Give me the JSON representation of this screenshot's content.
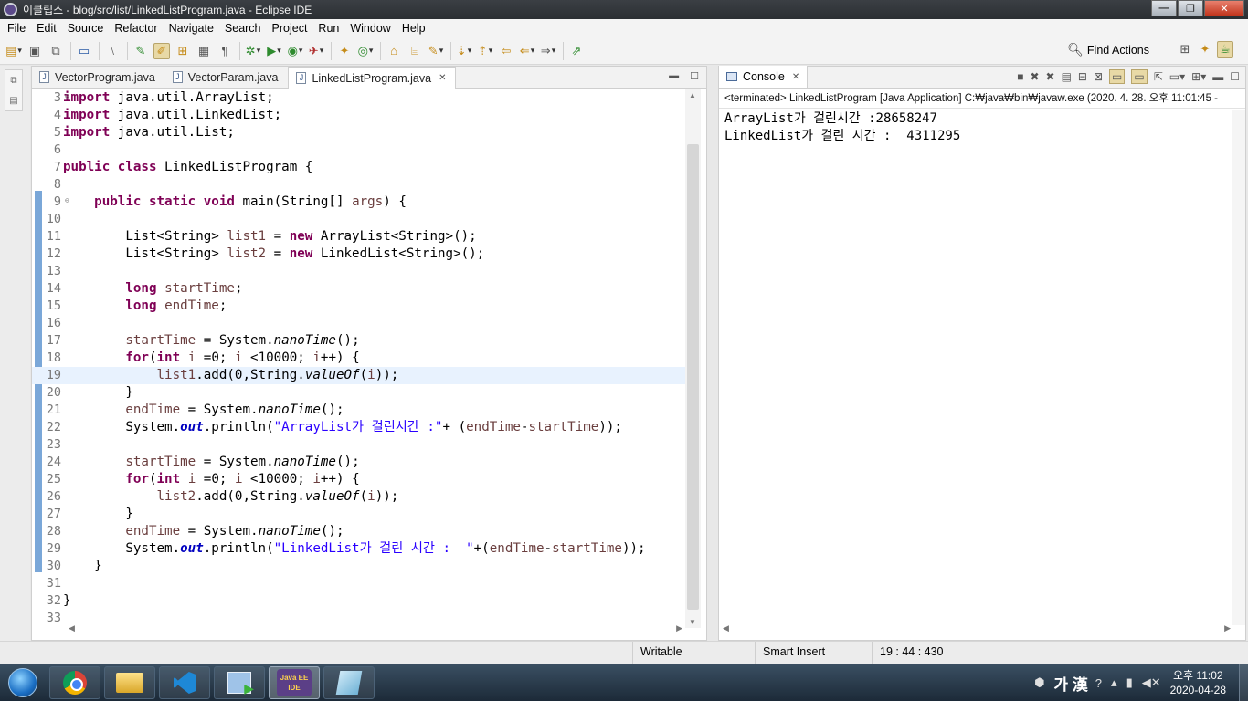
{
  "window": {
    "title": "이클립스 - blog/src/list/LinkedListProgram.java - Eclipse IDE",
    "controls": [
      "—",
      "❐",
      "✕"
    ]
  },
  "menu": [
    "File",
    "Edit",
    "Source",
    "Refactor",
    "Navigate",
    "Search",
    "Project",
    "Run",
    "Window",
    "Help"
  ],
  "toolbar": {
    "find_actions": "Find Actions"
  },
  "editor": {
    "tabs": [
      {
        "label": "VectorProgram.java",
        "active": false
      },
      {
        "label": "VectorParam.java",
        "active": false
      },
      {
        "label": "LinkedListProgram.java",
        "active": true
      }
    ],
    "line_numbers": [
      "3",
      "4",
      "5",
      "6",
      "7",
      "8",
      "9",
      "10",
      "11",
      "12",
      "13",
      "14",
      "15",
      "16",
      "17",
      "18",
      "19",
      "20",
      "21",
      "22",
      "23",
      "24",
      "25",
      "26",
      "27",
      "28",
      "29",
      "30",
      "31",
      "32",
      "33"
    ]
  },
  "console": {
    "tab_label": "Console",
    "terminated": "<terminated> LinkedListProgram [Java Application] C:₩java₩bin₩javaw.exe  (2020. 4. 28. 오후 11:01:45 -",
    "output": [
      "ArrayList가 걸린시간 :28658247",
      "LinkedList가 걸린 시간 :  4311295"
    ]
  },
  "status": {
    "writable": "Writable",
    "insert_mode": "Smart Insert",
    "position": "19 : 44 : 430"
  },
  "taskbar": {
    "ime": "가 漢",
    "time": "오후 11:02",
    "date": "2020-04-28",
    "eclipse_label_1": "Java EE",
    "eclipse_label_2": "IDE"
  },
  "colors": {
    "keyword": "#7f0055",
    "local_var": "#6a3e3e",
    "field": "#0000c0",
    "string": "#2a00ff",
    "current_line": "#e8f2fe"
  }
}
